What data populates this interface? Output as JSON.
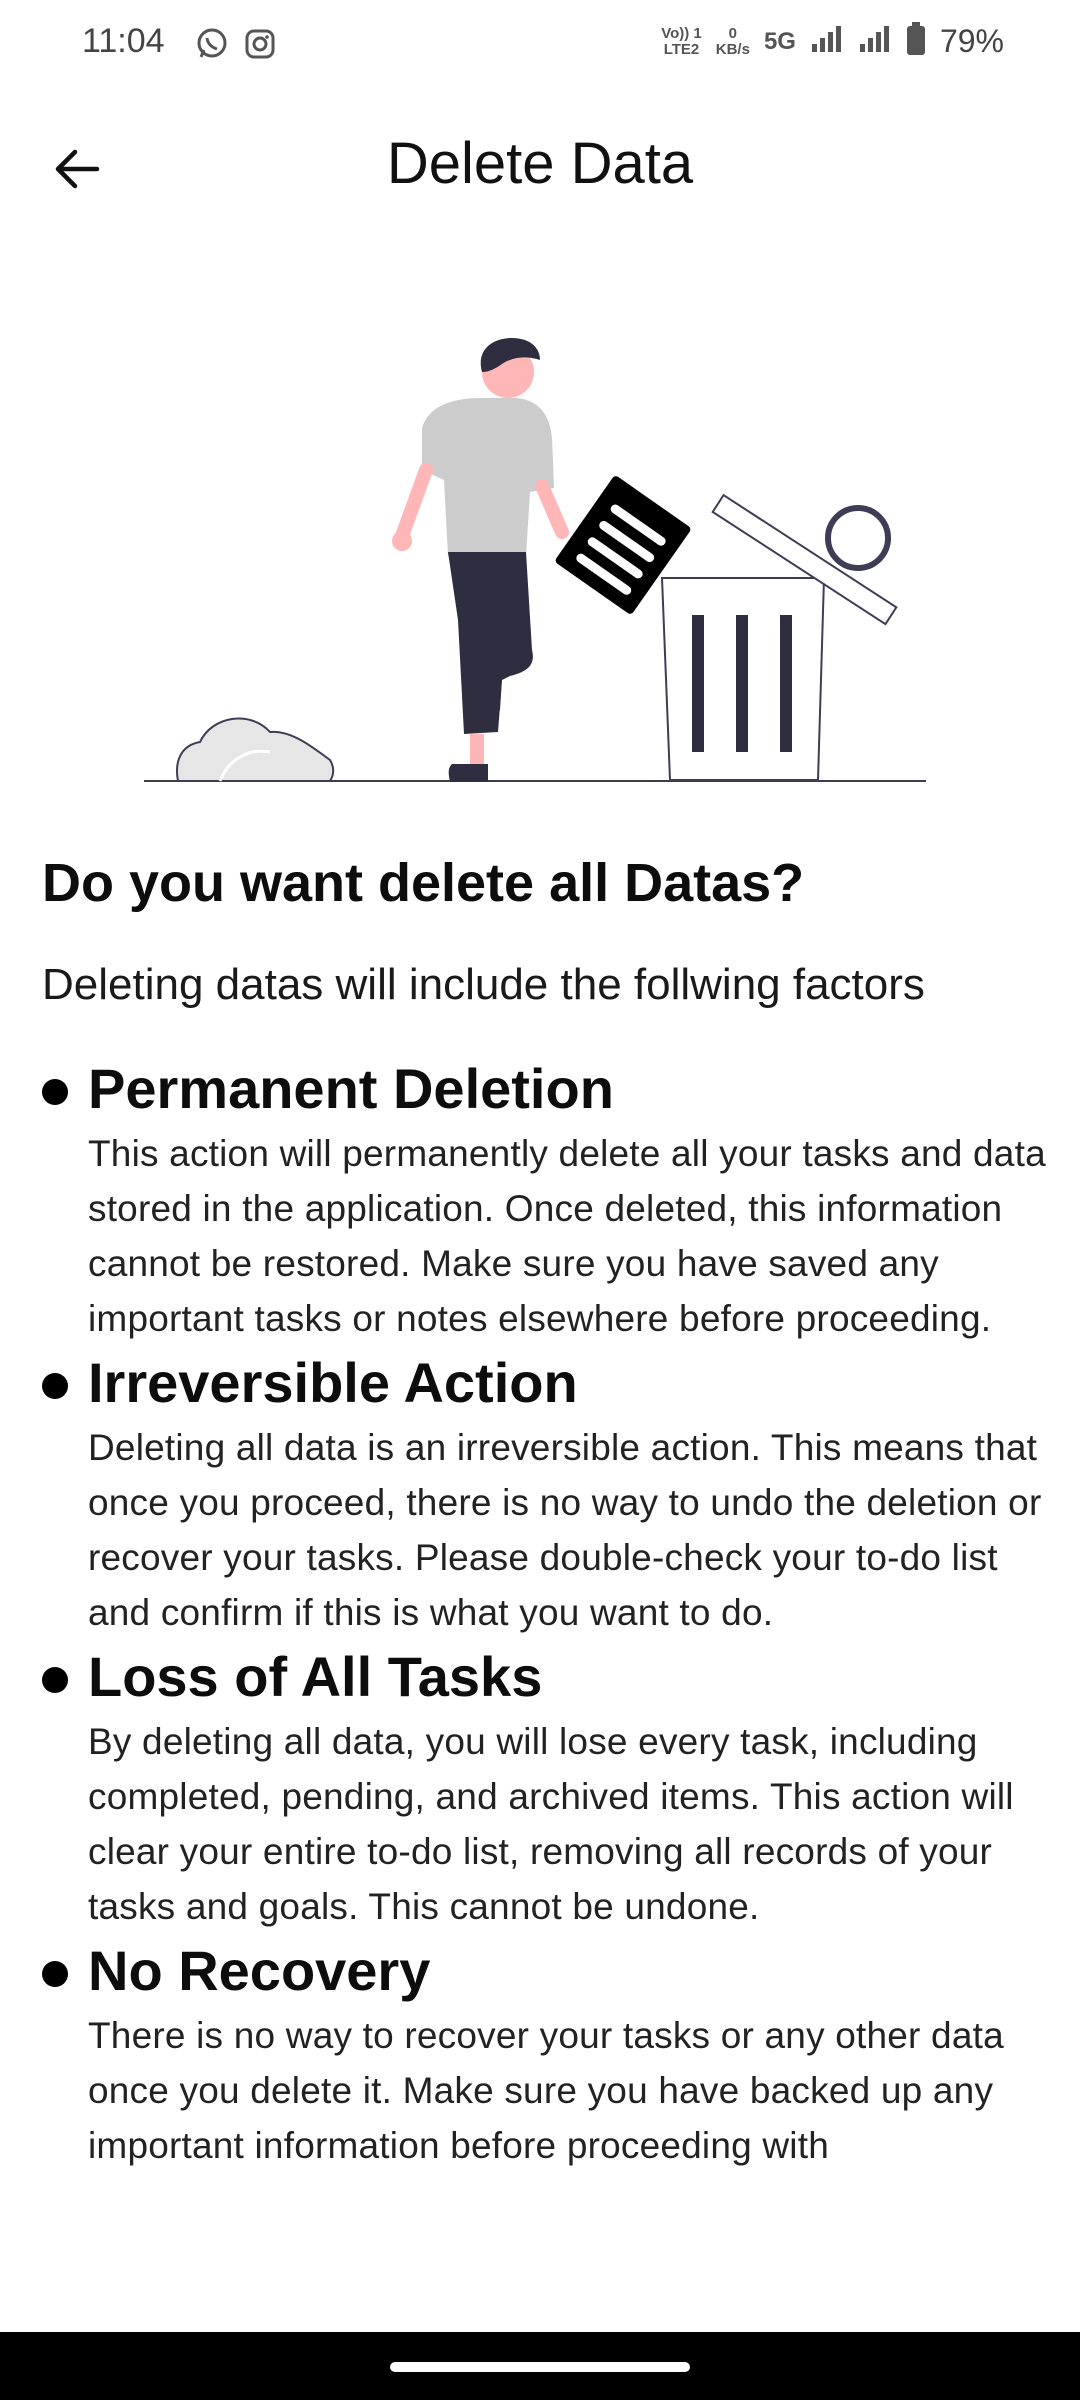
{
  "status_bar": {
    "time": "11:04",
    "volte_label_top": "Vo)) 1",
    "volte_label_bottom": "LTE2",
    "speed_value": "0",
    "speed_unit": "KB/s",
    "network": "5G",
    "battery": "79%"
  },
  "app_bar": {
    "title": "Delete Data",
    "back_icon": "arrow-left-icon"
  },
  "content": {
    "heading": "Do you want delete all Datas?",
    "intro": "Deleting datas will include the follwing factors",
    "factors": [
      {
        "title": "Permanent Deletion",
        "body": "This action will permanently delete all your tasks and data stored in the application. Once deleted, this information cannot be restored. Make sure you have saved any important tasks or notes elsewhere before proceeding."
      },
      {
        "title": "Irreversible Action",
        "body": "Deleting all data is an irreversible action. This means that once you proceed, there is no way to undo the deletion or recover your tasks. Please double-check your to-do list and confirm if this is what you want to do."
      },
      {
        "title": "Loss of All Tasks",
        "body": "By deleting all data, you will lose every task, including completed, pending, and archived items. This action will clear your entire to-do list, removing all records of your tasks and goals. This cannot be undone."
      },
      {
        "title": "No Recovery",
        "body": "There is no way to recover your tasks or any other data once you delete it. Make sure you have backed up any important information before proceeding with"
      }
    ]
  },
  "colors": {
    "figure_dark": "#2f2e41",
    "figure_skin": "#ffb6b6",
    "shirt": "#cccccc"
  }
}
